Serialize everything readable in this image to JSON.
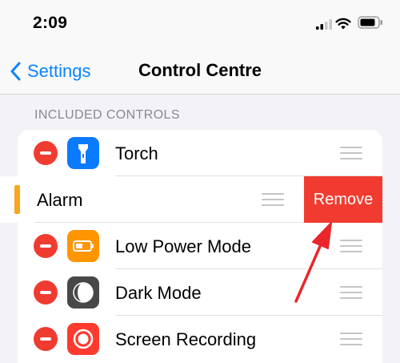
{
  "status_bar": {
    "time": "2:09"
  },
  "nav": {
    "back_label": "Settings",
    "title": "Control Centre"
  },
  "section": {
    "header": "INCLUDED CONTROLS"
  },
  "rows": [
    {
      "label": "Torch",
      "icon": "torch-icon",
      "color": "#0a7aff"
    },
    {
      "label": "Alarm",
      "icon": "alarm-icon",
      "color": "#f5a623"
    },
    {
      "label": "Low Power Mode",
      "icon": "battery-icon",
      "color": "#ff9500"
    },
    {
      "label": "Dark Mode",
      "icon": "dark-mode-icon",
      "color": "#48484a"
    },
    {
      "label": "Screen Recording",
      "icon": "record-icon",
      "color": "#ff3b30"
    }
  ],
  "swipe_action": {
    "label": "Remove",
    "color": "#f23b30"
  },
  "annotation": {
    "arrow_color": "#e8262c"
  }
}
